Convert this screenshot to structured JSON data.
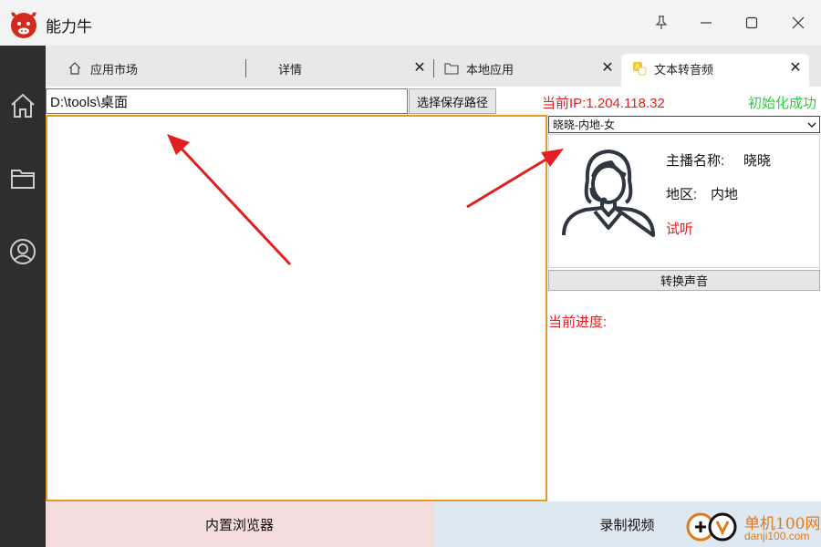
{
  "window": {
    "title": "能力牛"
  },
  "tabs": [
    {
      "label": "应用市场",
      "icon": "home-icon"
    },
    {
      "label": "详情"
    },
    {
      "label": "本地应用",
      "icon": "folder-icon"
    },
    {
      "label": "文本转音频",
      "icon": "text-to-audio-icon",
      "active": true
    }
  ],
  "path": {
    "value": "D:\\tools\\桌面",
    "button": "选择保存路径"
  },
  "status": {
    "ip": "当前IP:1.204.118.32",
    "init": "初始化成功"
  },
  "voice": {
    "selected": "晓晓-内地-女",
    "anchor_name_label": "主播名称:",
    "anchor_name": "晓晓",
    "region_label": "地区:",
    "region": "内地",
    "listen": "试听",
    "convert_button": "转换声音",
    "progress_label": "当前进度:"
  },
  "bottom": {
    "browser": "内置浏览器",
    "record": "录制视频"
  },
  "watermark": {
    "line1": "单机100网",
    "line2": "danji100.com"
  },
  "colors": {
    "accent_red": "#e02020",
    "success_green": "#2ecc40",
    "textarea_border": "#e89a1a"
  }
}
